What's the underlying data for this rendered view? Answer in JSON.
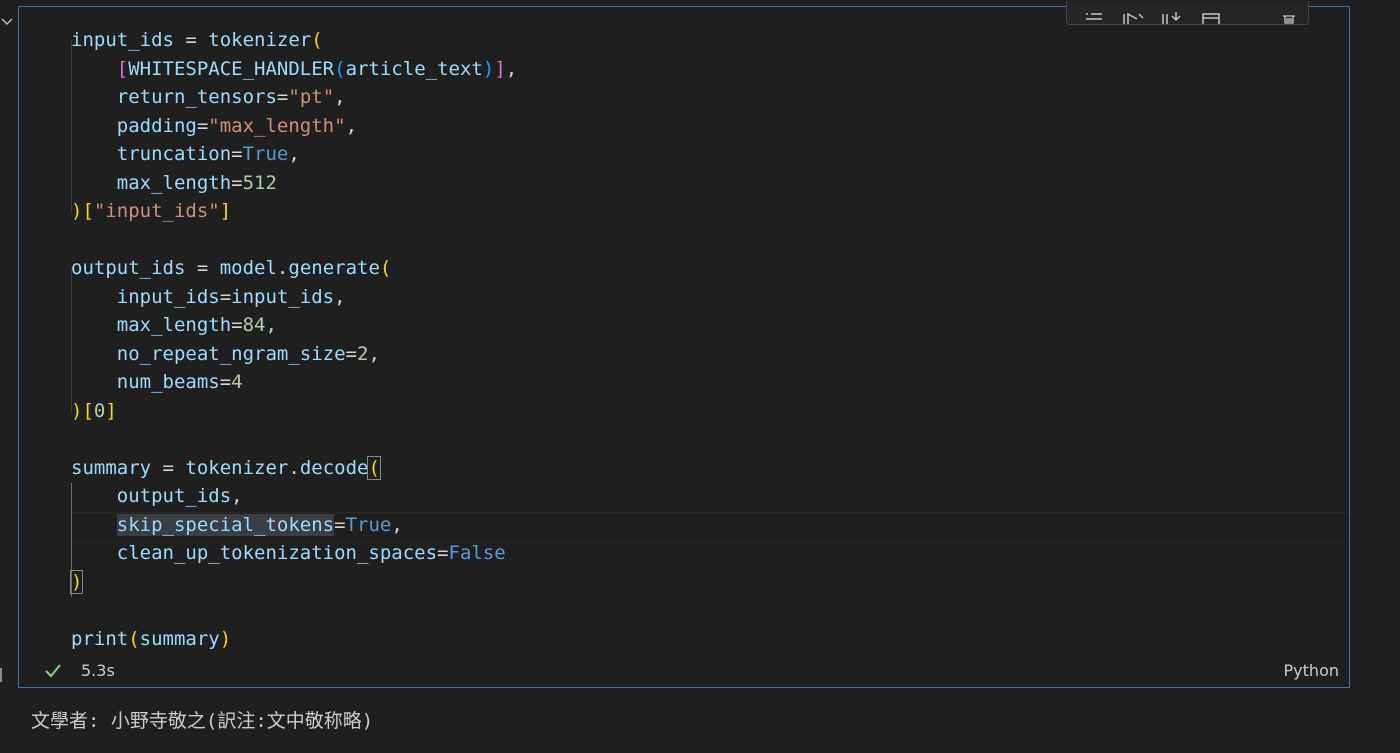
{
  "code": {
    "lines": [
      [
        [
          "k",
          "input_ids"
        ],
        [
          "t",
          " = "
        ],
        [
          "k",
          "tokenizer"
        ],
        [
          "p1",
          "("
        ]
      ],
      [
        [
          "t",
          "    "
        ],
        [
          "p2",
          "["
        ],
        [
          "k",
          "WHITESPACE_HANDLER"
        ],
        [
          "p3",
          "("
        ],
        [
          "k",
          "article_text"
        ],
        [
          "p3",
          ")"
        ],
        [
          "p2",
          "]"
        ],
        [
          "t",
          ","
        ]
      ],
      [
        [
          "t",
          "    "
        ],
        [
          "k",
          "return_tensors"
        ],
        [
          "t",
          "="
        ],
        [
          "s",
          "\"pt\""
        ],
        [
          "t",
          ","
        ]
      ],
      [
        [
          "t",
          "    "
        ],
        [
          "k",
          "padding"
        ],
        [
          "t",
          "="
        ],
        [
          "s",
          "\"max_length\""
        ],
        [
          "t",
          ","
        ]
      ],
      [
        [
          "t",
          "    "
        ],
        [
          "k",
          "truncation"
        ],
        [
          "t",
          "="
        ],
        [
          "kw",
          "True"
        ],
        [
          "t",
          ","
        ]
      ],
      [
        [
          "t",
          "    "
        ],
        [
          "k",
          "max_length"
        ],
        [
          "t",
          "="
        ],
        [
          "n",
          "512"
        ]
      ],
      [
        [
          "p1",
          ")"
        ],
        [
          "p1",
          "["
        ],
        [
          "s",
          "\"input_ids\""
        ],
        [
          "p1",
          "]"
        ]
      ],
      [],
      [
        [
          "k",
          "output_ids"
        ],
        [
          "t",
          " = "
        ],
        [
          "k",
          "model"
        ],
        [
          "t",
          "."
        ],
        [
          "k",
          "generate"
        ],
        [
          "p1",
          "("
        ]
      ],
      [
        [
          "t",
          "    "
        ],
        [
          "k",
          "input_ids"
        ],
        [
          "t",
          "="
        ],
        [
          "k",
          "input_ids"
        ],
        [
          "t",
          ","
        ]
      ],
      [
        [
          "t",
          "    "
        ],
        [
          "k",
          "max_length"
        ],
        [
          "t",
          "="
        ],
        [
          "n",
          "84"
        ],
        [
          "t",
          ","
        ]
      ],
      [
        [
          "t",
          "    "
        ],
        [
          "k",
          "no_repeat_ngram_size"
        ],
        [
          "t",
          "="
        ],
        [
          "n",
          "2"
        ],
        [
          "t",
          ","
        ]
      ],
      [
        [
          "t",
          "    "
        ],
        [
          "k",
          "num_beams"
        ],
        [
          "t",
          "="
        ],
        [
          "n",
          "4"
        ]
      ],
      [
        [
          "p1",
          ")"
        ],
        [
          "p1",
          "["
        ],
        [
          "n",
          "0"
        ],
        [
          "p1",
          "]"
        ]
      ],
      [],
      [
        [
          "k",
          "summary"
        ],
        [
          "t",
          " = "
        ],
        [
          "k",
          "tokenizer"
        ],
        [
          "t",
          "."
        ],
        [
          "k",
          "decode"
        ],
        [
          "p1m",
          "("
        ]
      ],
      [
        [
          "t",
          "    "
        ],
        [
          "k",
          "output_ids"
        ],
        [
          "t",
          ","
        ]
      ],
      [
        [
          "t",
          "    "
        ],
        [
          "ksel",
          "skip_special_tokens"
        ],
        [
          "t",
          "="
        ],
        [
          "kw",
          "True"
        ],
        [
          "t",
          ","
        ]
      ],
      [
        [
          "t",
          "    "
        ],
        [
          "k",
          "clean_up_tokenization_spaces"
        ],
        [
          "t",
          "="
        ],
        [
          "kw",
          "False"
        ]
      ],
      [
        [
          "p1m",
          ")"
        ]
      ],
      [],
      [
        [
          "k",
          "print"
        ],
        [
          "p1",
          "("
        ],
        [
          "k",
          "summary"
        ],
        [
          "p1",
          ")"
        ]
      ]
    ]
  },
  "status": {
    "exec_time": "5.3s",
    "language": "Python"
  },
  "output": {
    "text": "文學者: 小野寺敬之(訳注:文中敬称略)"
  },
  "colors": {
    "cell_border": "#3b73b4",
    "background": "#1f1f1f",
    "success": "#89d185"
  }
}
